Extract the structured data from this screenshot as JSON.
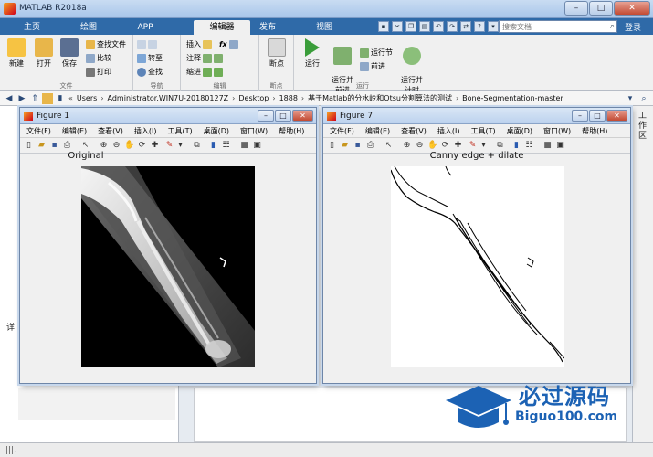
{
  "window": {
    "title": "MATLAB R2018a"
  },
  "ribbon_tabs": [
    "主页",
    "绘图",
    "APP",
    "编辑器",
    "发布",
    "视图"
  ],
  "active_tab": "编辑器",
  "search": {
    "placeholder": "搜索文档"
  },
  "login_label": "登录",
  "ribbon": {
    "file_group": {
      "label": "文件",
      "new": "新建",
      "open": "打开",
      "save": "保存",
      "find_files": "查找文件",
      "compare": "比较",
      "print": "打印"
    },
    "nav_group": {
      "label": "导航",
      "goto": "转至",
      "find": "查找"
    },
    "edit_group": {
      "label": "编辑",
      "insert": "插入",
      "comment": "注释",
      "indent": "缩进",
      "fx": "fx"
    },
    "breakpoint_group": {
      "label": "断点",
      "breakpoints": "断点"
    },
    "run_group": {
      "label": "运行",
      "run": "运行",
      "run_advance": "运行并\n前进",
      "run_section": "运行节",
      "advance": "前进",
      "run_time": "运行并\n计时"
    }
  },
  "address": {
    "crumbs": [
      "Users",
      "Administrator.WIN7U-20180127Z",
      "Desktop",
      "1888",
      "基于Matlab的分水岭和Otsu分割算法的测试",
      "Bone-Segmentation-master"
    ]
  },
  "left_panel": {
    "label": "详"
  },
  "right_strip": {
    "label": "工作区"
  },
  "figures": [
    {
      "title": "Figure 1",
      "menu": [
        "文件(F)",
        "编辑(E)",
        "查看(V)",
        "插入(I)",
        "工具(T)",
        "桌面(D)",
        "窗口(W)",
        "帮助(H)"
      ],
      "caption": "Original"
    },
    {
      "title": "Figure 7",
      "menu": [
        "文件(F)",
        "编辑(E)",
        "查看(V)",
        "插入(I)",
        "工具(T)",
        "桌面(D)",
        "窗口(W)",
        "帮助(H)"
      ],
      "caption": "Canny edge + dilate"
    }
  ],
  "watermark": {
    "cn": "必过源码",
    "en": "Biguo100.com"
  },
  "colors": {
    "tab_bar": "#2f6aa8",
    "ribbon_bg": "#f0f0f0",
    "watermark": "#1c62b4",
    "run_green": "#3a9d3a"
  }
}
